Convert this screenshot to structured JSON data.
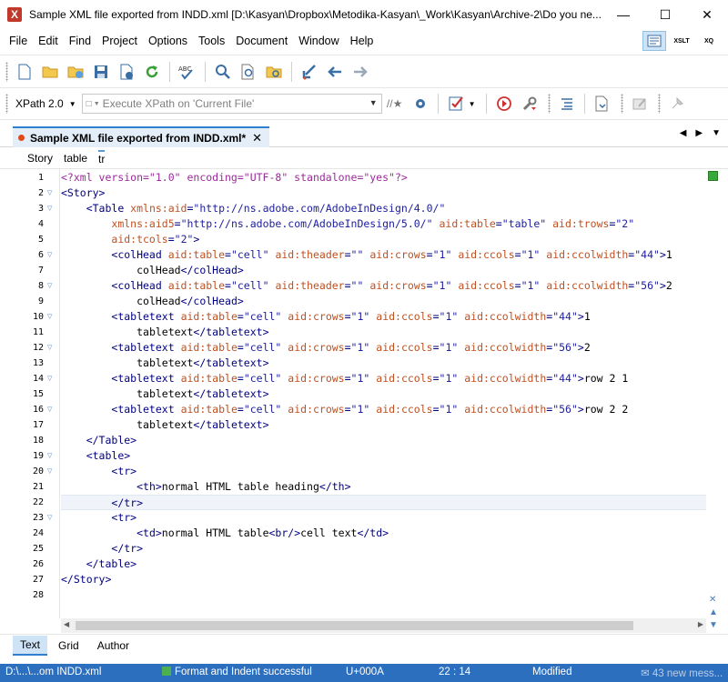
{
  "window": {
    "title": "Sample XML file exported from INDD.xml [D:\\Kasyan\\Dropbox\\Metodika-Kasyan\\_Work\\Kasyan\\Archive-2\\Do you ne..."
  },
  "menu": [
    "File",
    "Edit",
    "Find",
    "Project",
    "Options",
    "Tools",
    "Document",
    "Window",
    "Help"
  ],
  "toolbar_right": [
    "XSLT",
    "XQ"
  ],
  "xpath": {
    "version": "XPath 2.0",
    "placeholder": "Execute XPath on  'Current File'"
  },
  "tab": {
    "label": "Sample XML file exported from INDD.xml*"
  },
  "breadcrumb": [
    "Story",
    "table",
    "tr"
  ],
  "lines": [
    [
      {
        "t": "pi",
        "v": "<?xml version=\"1.0\" encoding=\"UTF-8\" standalone=\"yes\"?>"
      }
    ],
    [
      {
        "t": "tag",
        "v": "<Story>"
      }
    ],
    [
      {
        "t": "sp",
        "v": "    "
      },
      {
        "t": "tag",
        "v": "<Table "
      },
      {
        "t": "attr",
        "v": "xmlns:aid"
      },
      {
        "t": "tag",
        "v": "="
      },
      {
        "t": "val",
        "v": "\"http://ns.adobe.com/AdobeInDesign/4.0/\""
      }
    ],
    [
      {
        "t": "sp",
        "v": "        "
      },
      {
        "t": "attr",
        "v": "xmlns:aid5"
      },
      {
        "t": "tag",
        "v": "="
      },
      {
        "t": "val",
        "v": "\"http://ns.adobe.com/AdobeInDesign/5.0/\""
      },
      {
        "t": "sp",
        "v": " "
      },
      {
        "t": "attr",
        "v": "aid:table"
      },
      {
        "t": "tag",
        "v": "="
      },
      {
        "t": "val",
        "v": "\"table\""
      },
      {
        "t": "sp",
        "v": " "
      },
      {
        "t": "attr",
        "v": "aid:trows"
      },
      {
        "t": "tag",
        "v": "="
      },
      {
        "t": "val",
        "v": "\"2\""
      }
    ],
    [
      {
        "t": "sp",
        "v": "        "
      },
      {
        "t": "attr",
        "v": "aid:tcols"
      },
      {
        "t": "tag",
        "v": "="
      },
      {
        "t": "val",
        "v": "\"2\""
      },
      {
        "t": "tag",
        "v": ">"
      }
    ],
    [
      {
        "t": "sp",
        "v": "        "
      },
      {
        "t": "tag",
        "v": "<colHead "
      },
      {
        "t": "attr",
        "v": "aid:table"
      },
      {
        "t": "tag",
        "v": "="
      },
      {
        "t": "val",
        "v": "\"cell\""
      },
      {
        "t": "sp",
        "v": " "
      },
      {
        "t": "attr",
        "v": "aid:theader"
      },
      {
        "t": "tag",
        "v": "="
      },
      {
        "t": "val",
        "v": "\"\""
      },
      {
        "t": "sp",
        "v": " "
      },
      {
        "t": "attr",
        "v": "aid:crows"
      },
      {
        "t": "tag",
        "v": "="
      },
      {
        "t": "val",
        "v": "\"1\""
      },
      {
        "t": "sp",
        "v": " "
      },
      {
        "t": "attr",
        "v": "aid:ccols"
      },
      {
        "t": "tag",
        "v": "="
      },
      {
        "t": "val",
        "v": "\"1\""
      },
      {
        "t": "sp",
        "v": " "
      },
      {
        "t": "attr",
        "v": "aid:ccolwidth"
      },
      {
        "t": "tag",
        "v": "="
      },
      {
        "t": "val",
        "v": "\"44\""
      },
      {
        "t": "tag",
        "v": ">"
      },
      {
        "t": "text",
        "v": "1"
      }
    ],
    [
      {
        "t": "sp",
        "v": "            "
      },
      {
        "t": "text",
        "v": "colHead"
      },
      {
        "t": "tag",
        "v": "</colHead>"
      }
    ],
    [
      {
        "t": "sp",
        "v": "        "
      },
      {
        "t": "tag",
        "v": "<colHead "
      },
      {
        "t": "attr",
        "v": "aid:table"
      },
      {
        "t": "tag",
        "v": "="
      },
      {
        "t": "val",
        "v": "\"cell\""
      },
      {
        "t": "sp",
        "v": " "
      },
      {
        "t": "attr",
        "v": "aid:theader"
      },
      {
        "t": "tag",
        "v": "="
      },
      {
        "t": "val",
        "v": "\"\""
      },
      {
        "t": "sp",
        "v": " "
      },
      {
        "t": "attr",
        "v": "aid:crows"
      },
      {
        "t": "tag",
        "v": "="
      },
      {
        "t": "val",
        "v": "\"1\""
      },
      {
        "t": "sp",
        "v": " "
      },
      {
        "t": "attr",
        "v": "aid:ccols"
      },
      {
        "t": "tag",
        "v": "="
      },
      {
        "t": "val",
        "v": "\"1\""
      },
      {
        "t": "sp",
        "v": " "
      },
      {
        "t": "attr",
        "v": "aid:ccolwidth"
      },
      {
        "t": "tag",
        "v": "="
      },
      {
        "t": "val",
        "v": "\"56\""
      },
      {
        "t": "tag",
        "v": ">"
      },
      {
        "t": "text",
        "v": "2"
      }
    ],
    [
      {
        "t": "sp",
        "v": "            "
      },
      {
        "t": "text",
        "v": "colHead"
      },
      {
        "t": "tag",
        "v": "</colHead>"
      }
    ],
    [
      {
        "t": "sp",
        "v": "        "
      },
      {
        "t": "tag",
        "v": "<tabletext "
      },
      {
        "t": "attr",
        "v": "aid:table"
      },
      {
        "t": "tag",
        "v": "="
      },
      {
        "t": "val",
        "v": "\"cell\""
      },
      {
        "t": "sp",
        "v": " "
      },
      {
        "t": "attr",
        "v": "aid:crows"
      },
      {
        "t": "tag",
        "v": "="
      },
      {
        "t": "val",
        "v": "\"1\""
      },
      {
        "t": "sp",
        "v": " "
      },
      {
        "t": "attr",
        "v": "aid:ccols"
      },
      {
        "t": "tag",
        "v": "="
      },
      {
        "t": "val",
        "v": "\"1\""
      },
      {
        "t": "sp",
        "v": " "
      },
      {
        "t": "attr",
        "v": "aid:ccolwidth"
      },
      {
        "t": "tag",
        "v": "="
      },
      {
        "t": "val",
        "v": "\"44\""
      },
      {
        "t": "tag",
        "v": ">"
      },
      {
        "t": "text",
        "v": "1"
      }
    ],
    [
      {
        "t": "sp",
        "v": "            "
      },
      {
        "t": "text",
        "v": "tabletext"
      },
      {
        "t": "tag",
        "v": "</tabletext>"
      }
    ],
    [
      {
        "t": "sp",
        "v": "        "
      },
      {
        "t": "tag",
        "v": "<tabletext "
      },
      {
        "t": "attr",
        "v": "aid:table"
      },
      {
        "t": "tag",
        "v": "="
      },
      {
        "t": "val",
        "v": "\"cell\""
      },
      {
        "t": "sp",
        "v": " "
      },
      {
        "t": "attr",
        "v": "aid:crows"
      },
      {
        "t": "tag",
        "v": "="
      },
      {
        "t": "val",
        "v": "\"1\""
      },
      {
        "t": "sp",
        "v": " "
      },
      {
        "t": "attr",
        "v": "aid:ccols"
      },
      {
        "t": "tag",
        "v": "="
      },
      {
        "t": "val",
        "v": "\"1\""
      },
      {
        "t": "sp",
        "v": " "
      },
      {
        "t": "attr",
        "v": "aid:ccolwidth"
      },
      {
        "t": "tag",
        "v": "="
      },
      {
        "t": "val",
        "v": "\"56\""
      },
      {
        "t": "tag",
        "v": ">"
      },
      {
        "t": "text",
        "v": "2"
      }
    ],
    [
      {
        "t": "sp",
        "v": "            "
      },
      {
        "t": "text",
        "v": "tabletext"
      },
      {
        "t": "tag",
        "v": "</tabletext>"
      }
    ],
    [
      {
        "t": "sp",
        "v": "        "
      },
      {
        "t": "tag",
        "v": "<tabletext "
      },
      {
        "t": "attr",
        "v": "aid:table"
      },
      {
        "t": "tag",
        "v": "="
      },
      {
        "t": "val",
        "v": "\"cell\""
      },
      {
        "t": "sp",
        "v": " "
      },
      {
        "t": "attr",
        "v": "aid:crows"
      },
      {
        "t": "tag",
        "v": "="
      },
      {
        "t": "val",
        "v": "\"1\""
      },
      {
        "t": "sp",
        "v": " "
      },
      {
        "t": "attr",
        "v": "aid:ccols"
      },
      {
        "t": "tag",
        "v": "="
      },
      {
        "t": "val",
        "v": "\"1\""
      },
      {
        "t": "sp",
        "v": " "
      },
      {
        "t": "attr",
        "v": "aid:ccolwidth"
      },
      {
        "t": "tag",
        "v": "="
      },
      {
        "t": "val",
        "v": "\"44\""
      },
      {
        "t": "tag",
        "v": ">"
      },
      {
        "t": "text",
        "v": "row 2 1"
      }
    ],
    [
      {
        "t": "sp",
        "v": "            "
      },
      {
        "t": "text",
        "v": "tabletext"
      },
      {
        "t": "tag",
        "v": "</tabletext>"
      }
    ],
    [
      {
        "t": "sp",
        "v": "        "
      },
      {
        "t": "tag",
        "v": "<tabletext "
      },
      {
        "t": "attr",
        "v": "aid:table"
      },
      {
        "t": "tag",
        "v": "="
      },
      {
        "t": "val",
        "v": "\"cell\""
      },
      {
        "t": "sp",
        "v": " "
      },
      {
        "t": "attr",
        "v": "aid:crows"
      },
      {
        "t": "tag",
        "v": "="
      },
      {
        "t": "val",
        "v": "\"1\""
      },
      {
        "t": "sp",
        "v": " "
      },
      {
        "t": "attr",
        "v": "aid:ccols"
      },
      {
        "t": "tag",
        "v": "="
      },
      {
        "t": "val",
        "v": "\"1\""
      },
      {
        "t": "sp",
        "v": " "
      },
      {
        "t": "attr",
        "v": "aid:ccolwidth"
      },
      {
        "t": "tag",
        "v": "="
      },
      {
        "t": "val",
        "v": "\"56\""
      },
      {
        "t": "tag",
        "v": ">"
      },
      {
        "t": "text",
        "v": "row 2 2"
      }
    ],
    [
      {
        "t": "sp",
        "v": "            "
      },
      {
        "t": "text",
        "v": "tabletext"
      },
      {
        "t": "tag",
        "v": "</tabletext>"
      }
    ],
    [
      {
        "t": "sp",
        "v": "    "
      },
      {
        "t": "tag",
        "v": "</Table>"
      }
    ],
    [
      {
        "t": "sp",
        "v": "    "
      },
      {
        "t": "tag",
        "v": "<table>"
      }
    ],
    [
      {
        "t": "sp",
        "v": "        "
      },
      {
        "t": "tag",
        "v": "<tr>"
      }
    ],
    [
      {
        "t": "sp",
        "v": "            "
      },
      {
        "t": "tag",
        "v": "<th>"
      },
      {
        "t": "text",
        "v": "normal HTML table heading"
      },
      {
        "t": "tag",
        "v": "</th>"
      }
    ],
    [
      {
        "t": "sp",
        "v": "        "
      },
      {
        "t": "tag",
        "v": "</tr>"
      }
    ],
    [
      {
        "t": "sp",
        "v": "        "
      },
      {
        "t": "tag",
        "v": "<tr>"
      }
    ],
    [
      {
        "t": "sp",
        "v": "            "
      },
      {
        "t": "tag",
        "v": "<td>"
      },
      {
        "t": "text",
        "v": "normal HTML table"
      },
      {
        "t": "tag",
        "v": "<br/>"
      },
      {
        "t": "text",
        "v": "cell text"
      },
      {
        "t": "tag",
        "v": "</td>"
      }
    ],
    [
      {
        "t": "sp",
        "v": "        "
      },
      {
        "t": "tag",
        "v": "</tr>"
      }
    ],
    [
      {
        "t": "sp",
        "v": "    "
      },
      {
        "t": "tag",
        "v": "</table>"
      }
    ],
    [
      {
        "t": "tag",
        "v": "</Story>"
      }
    ],
    []
  ],
  "line_numbers": [
    "1",
    "2",
    "3",
    "4",
    "5",
    "6",
    "7",
    "8",
    "9",
    "10",
    "11",
    "12",
    "13",
    "14",
    "15",
    "16",
    "17",
    "18",
    "19",
    "20",
    "21",
    "22",
    "23",
    "24",
    "25",
    "26",
    "27",
    "28"
  ],
  "fold_lines": [
    2,
    3,
    6,
    8,
    10,
    12,
    14,
    16,
    19,
    20,
    23
  ],
  "current_line": 22,
  "modes": [
    "Text",
    "Grid",
    "Author"
  ],
  "status": {
    "path": "D:\\...\\...om INDD.xml",
    "message": "Format and Indent successful",
    "unicode": "U+000A",
    "position": "22 : 14",
    "state": "Modified",
    "notifications": "43 new mess..."
  },
  "colors": {
    "tag": "#000080",
    "attr": "#c05020",
    "value": "#2020a0",
    "status_bar": "#2d6fbf",
    "tab_accent": "#2f7fd0"
  }
}
